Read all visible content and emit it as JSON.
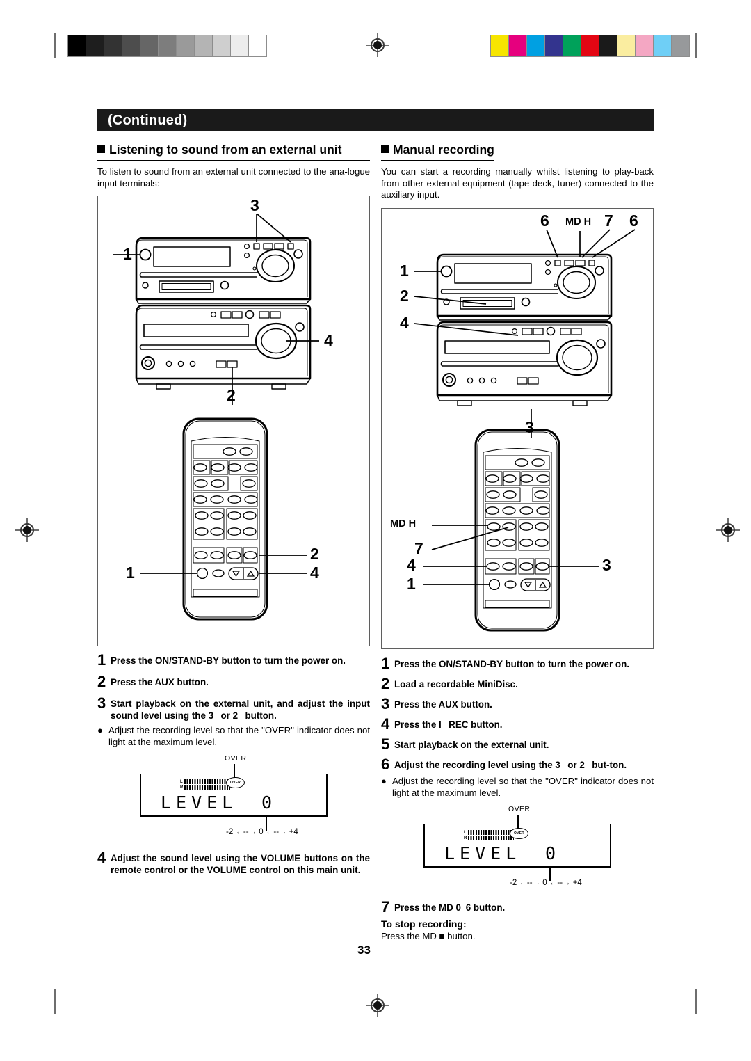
{
  "document": {
    "continued_label": "(Continued)",
    "page_number": "33"
  },
  "print_marks": {
    "grey_bar": [
      "#000000",
      "#1e1e1e",
      "#333333",
      "#4d4d4d",
      "#666666",
      "#7d7d7d",
      "#9a9a9a",
      "#b4b4b4",
      "#cfcfcf",
      "#ededed",
      "#ffffff"
    ],
    "color_bar": [
      "#f7e500",
      "#e6007e",
      "#00a0e2",
      "#33348e",
      "#00a15a",
      "#e30613",
      "#1a1a1a",
      "#faeda0",
      "#f4a7c3",
      "#6fcff6",
      "#97999b"
    ]
  },
  "left_column": {
    "heading": "Listening to sound from an external unit",
    "intro": "To listen to sound from an external unit connected to the ana-logue input terminals:",
    "figure": {
      "name": "system-and-remote-illustration",
      "callouts": [
        "1",
        "3",
        "4",
        "2",
        "1",
        "2",
        "4"
      ]
    },
    "steps": [
      {
        "n": "1",
        "text": "Press the ON/STAND-BY button to turn the power on."
      },
      {
        "n": "2",
        "text": "Press the AUX button."
      },
      {
        "n": "3",
        "text": "Start playback on the external unit, and adjust the input sound level using the 3  or 2  button."
      }
    ],
    "bullet": "Adjust the recording level so that the \"OVER\" indicator does not light at the maximum level.",
    "level_display": {
      "over_label": "OVER",
      "over_badge": "OVER",
      "left_channel": "L",
      "right_channel": "R",
      "level_text": "LEVEL",
      "level_value": "0",
      "scale": "-2 ←--→ 0 ←--→ +4"
    },
    "step4": {
      "n": "4",
      "text": "Adjust the sound level using the VOLUME buttons on the remote control or the VOLUME control on this main unit."
    }
  },
  "right_column": {
    "heading": "Manual recording",
    "intro": "You can start a recording manually whilst listening to play-back from other external equipment (tape deck, tuner) connected to the auxiliary input.",
    "figure": {
      "name": "system-and-remote-illustration",
      "top_labels": [
        "6",
        "MD H",
        "7",
        "6"
      ],
      "md_remote_label": "MD H",
      "callouts": [
        "1",
        "2",
        "4",
        "3",
        "7",
        "4",
        "1",
        "3"
      ]
    },
    "steps": [
      {
        "n": "1",
        "text": "Press the ON/STAND-BY button to turn the power on."
      },
      {
        "n": "2",
        "text": "Load a recordable MiniDisc."
      },
      {
        "n": "3",
        "text": "Press the AUX button."
      },
      {
        "n": "4",
        "text": "Press the I  REC button."
      },
      {
        "n": "5",
        "text": "Start playback on the external unit."
      },
      {
        "n": "6",
        "text": "Adjust the  recording level using the 3  or 2  but-ton."
      }
    ],
    "bullet": "Adjust the recording level so that the \"OVER\" indicator does not light at the maximum level.",
    "level_display": {
      "over_label": "OVER",
      "over_badge": "OVER",
      "left_channel": "L",
      "right_channel": "R",
      "level_text": "LEVEL",
      "level_value": "0",
      "scale": "-2 ←--→ 0 ←--→ +4"
    },
    "step7": {
      "n": "7",
      "text": "Press the MD 0 6 button."
    },
    "stop_heading": "To stop recording:",
    "stop_text": "Press the MD ■ button."
  }
}
